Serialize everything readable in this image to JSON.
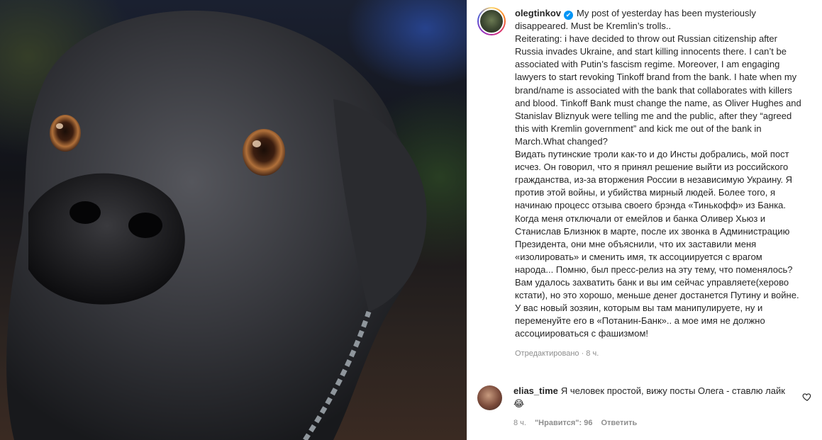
{
  "post": {
    "username": "olegtinkov",
    "caption_paragraphs": [
      "My post of yesterday has been mysteriously disappeared. Must be Kremlin’s trolls..",
      "Reiterating: i have decided to throw out Russian citizenship after Russia invades Ukraine, and start killing innocents there. I can’t be associated with Putin’s fascism regime. Moreover, I am engaging lawyers to start revoking Tinkoff brand from the bank. I hate when my brand/name is associated with the bank that collaborates with killers and blood. Tinkoff Bank must change the name, as Oliver Hughes and Stanislav Bliznyuk were telling me and the public, after they “agreed this with Kremlin government” and kick me out of the bank in March.What changed?",
      "Видать путинские троли как-то и до Инсты добрались, мой пост исчез. Он говорил, что я принял решение выйти из российского гражданства, из-за вторжения России в независимую Украину. Я против этой войны, и убийства мирный людей. Более того, я начинаю процесс отзыва своего брэнда «Тинькофф» из Банка. Когда меня отключали от емейлов и банка Оливер Хьюз и Станислав Близнюк в марте, после их звонка в Администрацию Президента, они мне объяснили, что их заставили меня «изолировать» и сменить имя, тк ассоциируется с врагом народа... Помню, был пресс-релиз на эту тему, что поменялось? Вам удалось захватить банк и вы им сейчас управляете(херово кстати), но это хорошо, меньше денег достанется Путину и войне. У вас новый зозяин, которым вы там манипулируете, ну и переменуйте его в «Потанин-Банк».. а мое имя не должно ассоциироваться с фашизмом!"
    ],
    "verified_icon": "✔",
    "meta": "Отредактировано · 8 ч."
  },
  "comment": {
    "username": "elias_time",
    "text": "Я человек простой, вижу посты Олега - ставлю лайк 😂",
    "time": "8 ч.",
    "likes": "\"Нравится\": 96",
    "reply_label": "Ответить"
  },
  "colors": {
    "accent": "#0095f6",
    "text": "#262626",
    "muted": "#8e8e8e"
  }
}
